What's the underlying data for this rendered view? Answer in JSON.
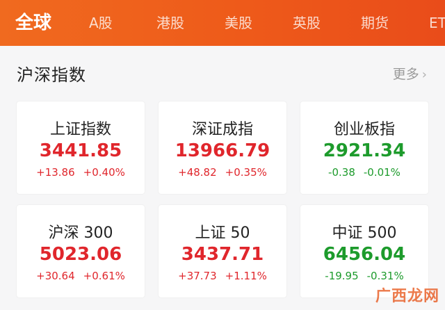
{
  "tabs": [
    {
      "label": "全球",
      "active": true
    },
    {
      "label": "A股",
      "active": false
    },
    {
      "label": "港股",
      "active": false
    },
    {
      "label": "美股",
      "active": false
    },
    {
      "label": "英股",
      "active": false
    },
    {
      "label": "期货",
      "active": false
    },
    {
      "label": "ET",
      "active": false
    }
  ],
  "section": {
    "title": "沪深指数",
    "more_label": "更多",
    "more_icon": "chevron-right-icon"
  },
  "cards": [
    {
      "name": "上证指数",
      "price": "3441.85",
      "change": "+13.86",
      "percent": "+0.40%",
      "trend": "up"
    },
    {
      "name": "深证成指",
      "price": "13966.79",
      "change": "+48.82",
      "percent": "+0.35%",
      "trend": "up"
    },
    {
      "name": "创业板指",
      "price": "2921.34",
      "change": "-0.38",
      "percent": "-0.01%",
      "trend": "down"
    },
    {
      "name": "沪深 300",
      "price": "5023.06",
      "change": "+30.64",
      "percent": "+0.61%",
      "trend": "up"
    },
    {
      "name": "上证 50",
      "price": "3437.71",
      "change": "+37.73",
      "percent": "+1.11%",
      "trend": "up"
    },
    {
      "name": "中证 500",
      "price": "6456.04",
      "change": "-19.95",
      "percent": "-0.31%",
      "trend": "down"
    }
  ],
  "watermark": "广西龙网",
  "colors": {
    "header": "#ee5a1a",
    "up": "#e0262c",
    "down": "#1d9b2c"
  }
}
